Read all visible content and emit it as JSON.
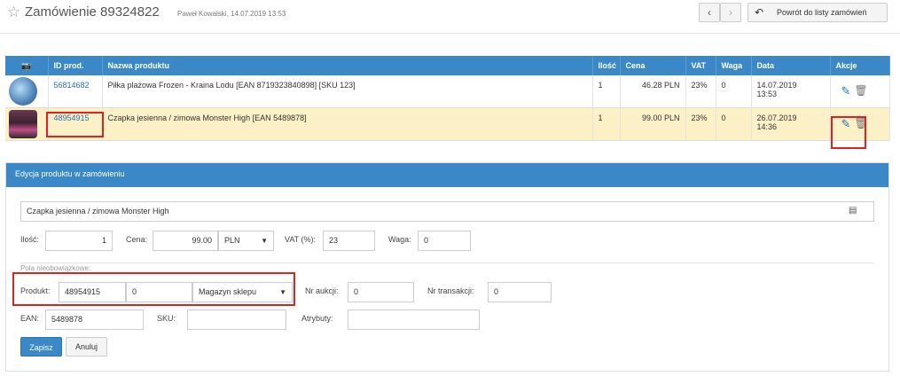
{
  "header": {
    "star_icon": "star-outline-icon",
    "title": "Zamówienie 89324822",
    "subtitle": "Paweł Kowalski, 14.07.2019 13:53",
    "prev_icon": "chevron-left-icon",
    "next_icon": "chevron-right-icon",
    "back_label": "Powrót do listy zamówień"
  },
  "table": {
    "columns": [
      "",
      "ID prod.",
      "Nazwa produktu",
      "Ilość",
      "Cena",
      "VAT",
      "Waga",
      "Data",
      "Akcje"
    ],
    "rows": [
      {
        "id": "56814682",
        "name": "Piłka plażowa Frozen - Kraina Lodu [EAN 8719323840898] [SKU 123]",
        "qty": "1",
        "price": "46.28 PLN",
        "vat": "23%",
        "weight": "0",
        "date": "14.07.2019",
        "time": "13:53"
      },
      {
        "id": "48954915",
        "name": "Czapka jesienna / zimowa Monster High [EAN 5489878]",
        "qty": "1",
        "price": "99.00 PLN",
        "vat": "23%",
        "weight": "0",
        "date": "26.07.2019",
        "time": "14:36"
      }
    ]
  },
  "edit": {
    "heading": "Edycja produktu w zamówieniu",
    "name_value": "Czapka jesienna / zimowa Monster High",
    "qty_label": "Ilość:",
    "qty_value": "1",
    "price_label": "Cena:",
    "price_value": "99.00",
    "currency": "PLN",
    "vat_label": "VAT (%):",
    "vat_value": "23",
    "weight_label": "Waga:",
    "weight_value": "0",
    "optional_label": "Pola nieobowiązkowe:",
    "product_label": "Produkt:",
    "product_id": "48954915",
    "product_variant": "0",
    "warehouse": "Magazyn sklepu",
    "auction_label": "Nr aukcji:",
    "auction_value": "0",
    "transaction_label": "Nr transakcji:",
    "transaction_value": "0",
    "ean_label": "EAN:",
    "ean_value": "5489878",
    "sku_label": "SKU:",
    "sku_value": "",
    "attributes_label": "Atrybuty:",
    "attributes_value": "",
    "save_label": "Zapisz",
    "cancel_label": "Anuluj"
  },
  "colors": {
    "header_blue": "#3a88c8",
    "highlight_row": "#fbf0c6",
    "annotation_red": "#d22222"
  }
}
